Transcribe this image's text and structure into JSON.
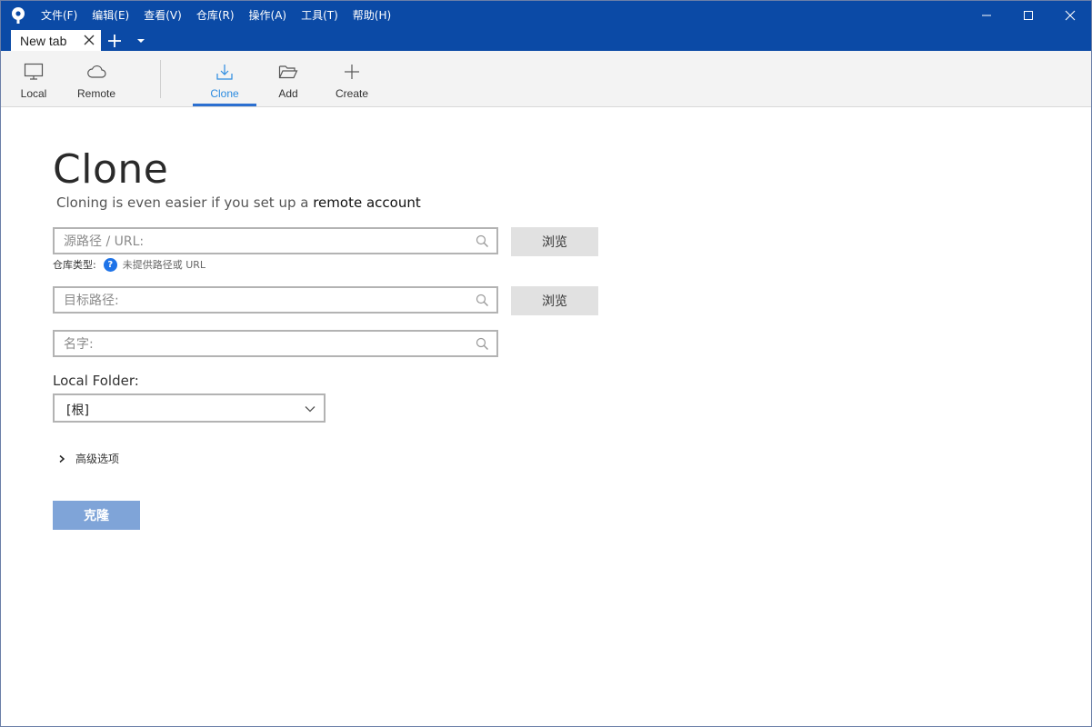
{
  "menu": {
    "items": [
      "文件(F)",
      "编辑(E)",
      "查看(V)",
      "仓库(R)",
      "操作(A)",
      "工具(T)",
      "帮助(H)"
    ]
  },
  "tabs": {
    "active_label": "New tab"
  },
  "toolbar": {
    "local": "Local",
    "remote": "Remote",
    "clone": "Clone",
    "add": "Add",
    "create": "Create",
    "active": "Clone"
  },
  "main": {
    "title": "Clone",
    "subtitle_prefix": "Cloning is even easier if you set up a ",
    "subtitle_link": "remote account",
    "source_placeholder": "源路径 / URL:",
    "dest_placeholder": "目标路径:",
    "name_placeholder": "名字:",
    "browse_label": "浏览",
    "repo_type_label": "仓库类型:",
    "repo_type_value": "未提供路径或 URL",
    "local_folder_label": "Local Folder:",
    "local_folder_value": "[根]",
    "advanced_label": "高级选项",
    "clone_button": "克隆"
  },
  "colors": {
    "titlebar": "#0b4aa6",
    "accent": "#2b6fd0",
    "clone_button": "#7fa4d8"
  }
}
